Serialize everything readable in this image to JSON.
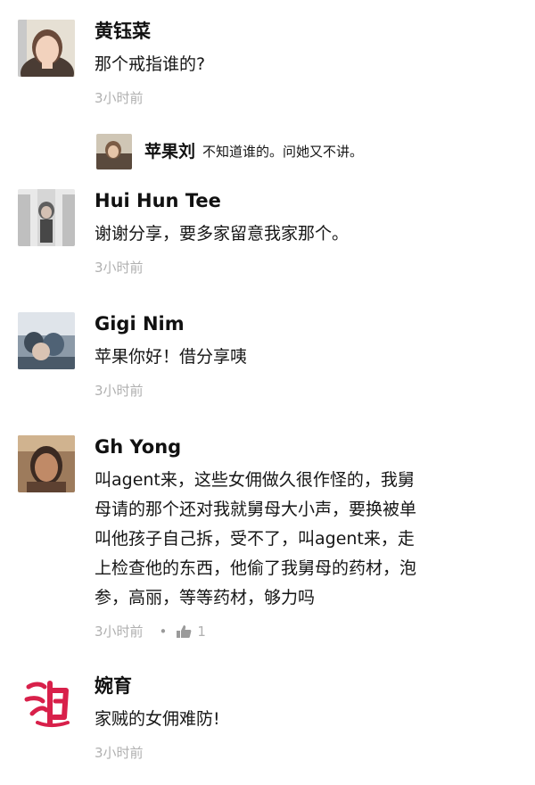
{
  "comments": [
    {
      "name": "黄钰菜",
      "text": "那个戒指谁的?",
      "time": "3小时前",
      "reply": {
        "name": "苹果刘",
        "text": "不知道谁的。问她又不讲。"
      }
    },
    {
      "name": "Hui Hun Tee",
      "text": "谢谢分享，要多家留意我家那个。",
      "time": "3小时前"
    },
    {
      "name": "Gigi Nim",
      "text": "苹果你好！借分享咦",
      "time": "3小时前"
    },
    {
      "name": "Gh Yong",
      "text_lines": [
        "叫agent来，这些女佣做久很作怪的，我舅",
        "母请的那个还对我就舅母大小声，要换被单",
        "叫他孩子自己拆，受不了，叫agent来，走",
        "上检查他的东西，他偷了我舅母的药材，泡",
        "参，高丽，等等药材，够力吗"
      ],
      "time": "3小时前",
      "like_count": "1"
    },
    {
      "name": "婉育",
      "text": "家贼的女佣难防!",
      "time": "3小时前"
    }
  ],
  "icons": {
    "like": "thumbs-up-icon"
  },
  "colors": {
    "text": "#161616",
    "meta": "#b0b0b0"
  }
}
